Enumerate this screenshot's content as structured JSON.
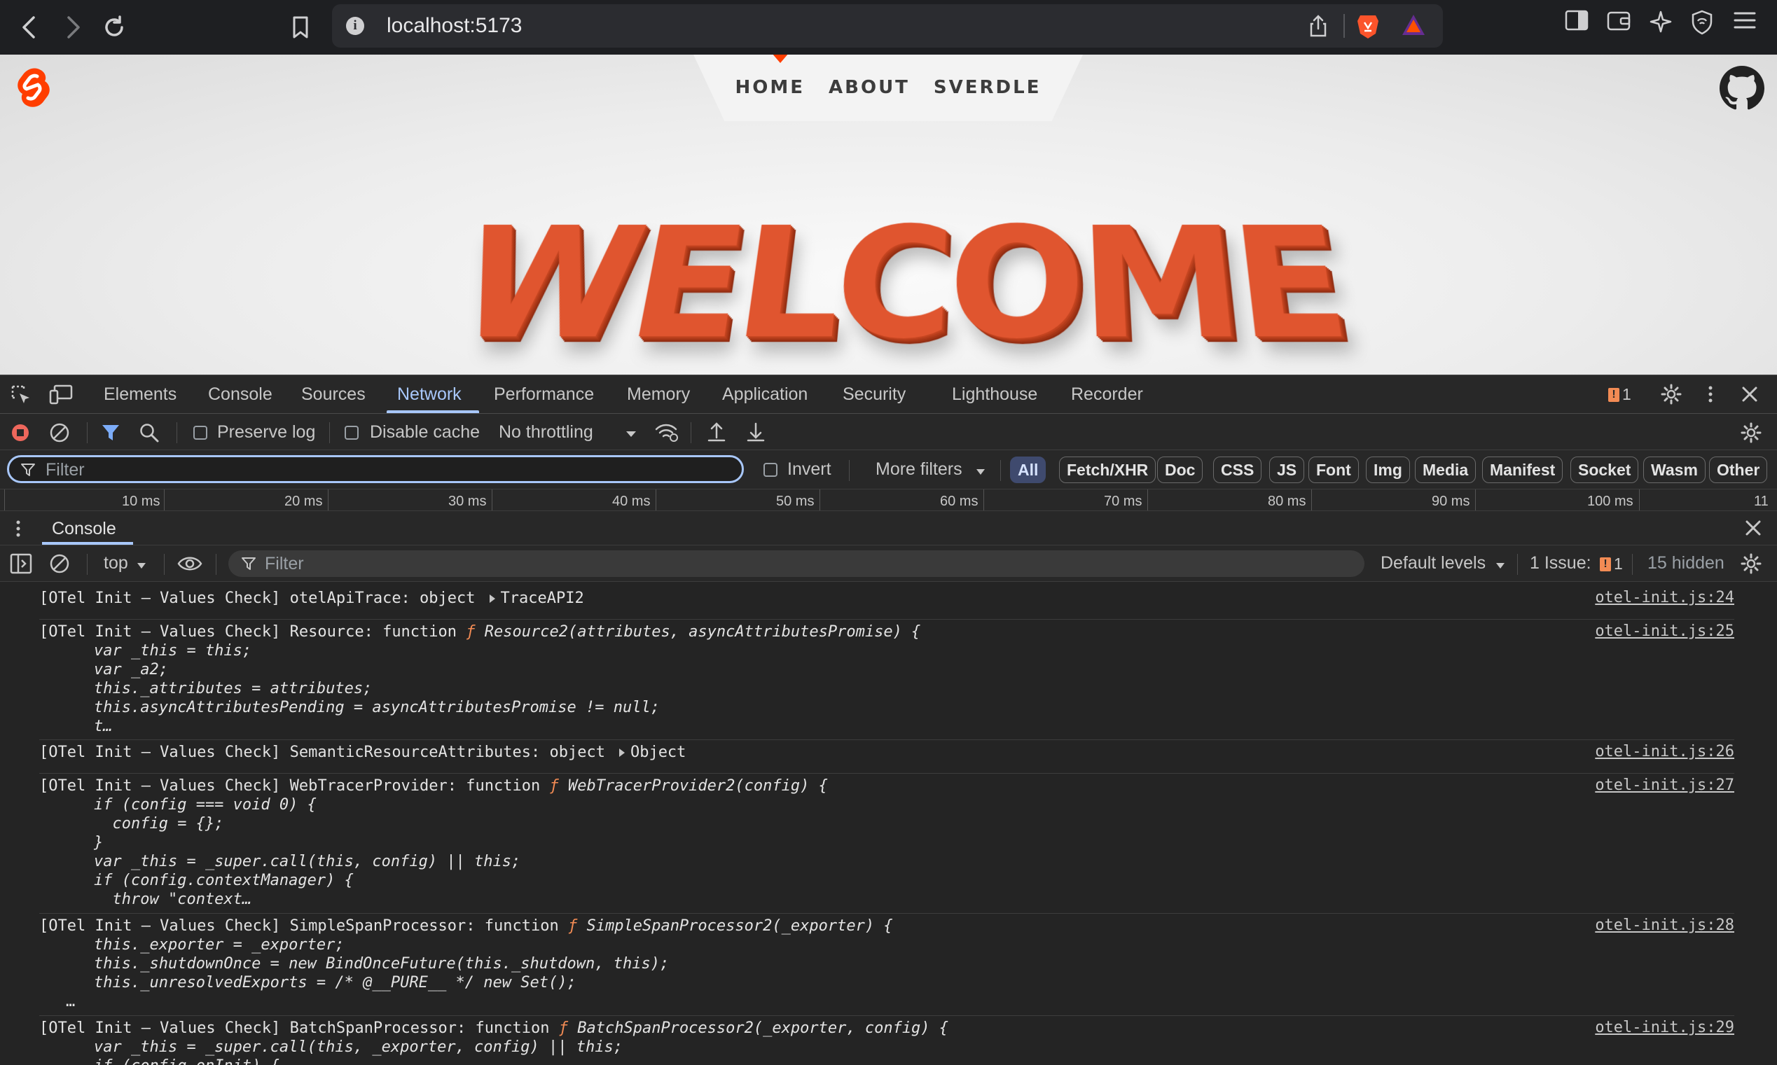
{
  "browser": {
    "url": "localhost:5173"
  },
  "site": {
    "nav": [
      "HOME",
      "ABOUT",
      "SVERDLE"
    ],
    "hero_text": "WELCOME"
  },
  "devtools": {
    "tabs": [
      "Elements",
      "Console",
      "Sources",
      "Network",
      "Performance",
      "Memory",
      "Application",
      "Security",
      "Lighthouse",
      "Recorder"
    ],
    "active_tab": "Network",
    "issues_badge": "1",
    "network": {
      "preserve_log": "Preserve log",
      "disable_cache": "Disable cache",
      "throttling": "No throttling",
      "filter_placeholder": "Filter",
      "invert": "Invert",
      "more_filters": "More filters",
      "type_filters": [
        "All",
        "Fetch/XHR",
        "Doc",
        "CSS",
        "JS",
        "Font",
        "Img",
        "Media",
        "Manifest",
        "Socket",
        "Wasm",
        "Other"
      ],
      "timeline_ticks": [
        "10 ms",
        "20 ms",
        "30 ms",
        "40 ms",
        "50 ms",
        "60 ms",
        "70 ms",
        "80 ms",
        "90 ms",
        "100 ms",
        "11"
      ]
    },
    "console": {
      "drawer_tab": "Console",
      "context": "top",
      "filter_placeholder": "Filter",
      "levels": "Default levels",
      "issues_label": "1 Issue:",
      "issues_count": "1",
      "hidden": "15 hidden",
      "logs": [
        {
          "prefix": "[OTel Init – Values Check] otelApiTrace: object",
          "expandable": "TraceAPI2",
          "source": "otel-init.js:24"
        },
        {
          "prefix": "[OTel Init – Values Check] Resource: function",
          "fn_glyph": "ƒ",
          "signature": "Resource2(attributes, asyncAttributesPromise) {",
          "body": [
            "var _this = this;",
            "var _a2;",
            "this._attributes = attributes;",
            "this.asyncAttributesPending = asyncAttributesPromise != null;",
            "t…"
          ],
          "source": "otel-init.js:25"
        },
        {
          "prefix": "[OTel Init – Values Check] SemanticResourceAttributes: object",
          "expandable": "Object",
          "source": "otel-init.js:26"
        },
        {
          "prefix": "[OTel Init – Values Check] WebTracerProvider: function",
          "fn_glyph": "ƒ",
          "signature": "WebTracerProvider2(config) {",
          "body": [
            "if (config === void 0) {",
            "  config = {};",
            "}",
            "var _this = _super.call(this, config) || this;",
            "if (config.contextManager) {",
            "  throw \"context…"
          ],
          "source": "otel-init.js:27"
        },
        {
          "prefix": "[OTel Init – Values Check] SimpleSpanProcessor: function",
          "fn_glyph": "ƒ",
          "signature": "SimpleSpanProcessor2(_exporter) {",
          "body": [
            "this._exporter = _exporter;",
            "this._shutdownOnce = new BindOnceFuture(this._shutdown, this);",
            "this._unresolvedExports = /* @__PURE__ */ new Set();",
            "…"
          ],
          "source": "otel-init.js:28"
        },
        {
          "prefix": "[OTel Init – Values Check] BatchSpanProcessor: function",
          "fn_glyph": "ƒ",
          "signature": "BatchSpanProcessor2(_exporter, config) {",
          "body": [
            "var _this = _super.call(this, _exporter, config) || this;",
            "if (config.onInit) {"
          ],
          "source": "otel-init.js:29"
        }
      ]
    }
  },
  "colors": {
    "accent": "#a8c7fa",
    "svelte": "#ff3e00",
    "function_glyph": "#f28b54"
  }
}
